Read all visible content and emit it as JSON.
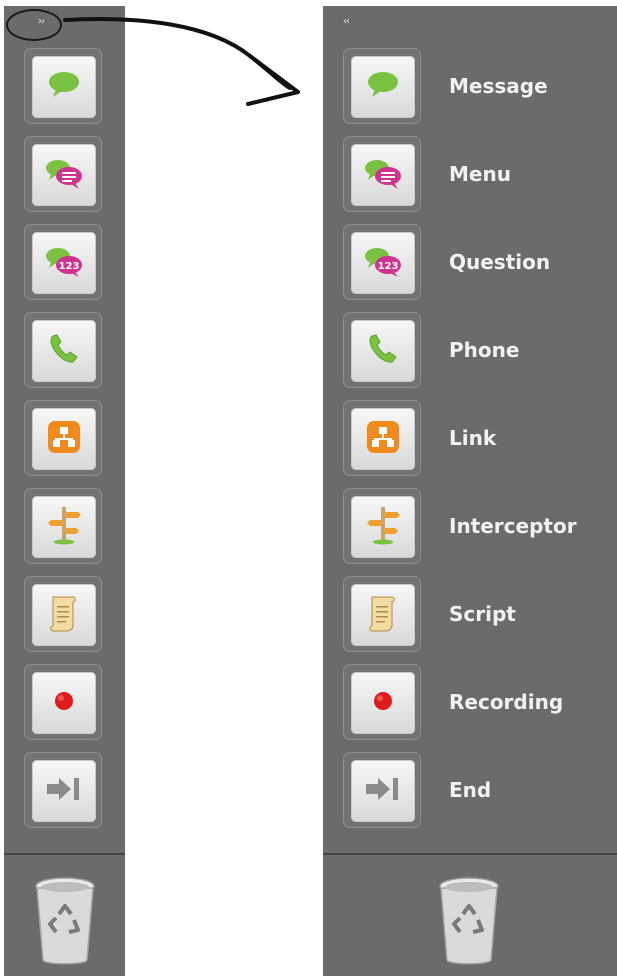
{
  "collapsed_panel": {
    "toggle_label": "››",
    "tools": [
      {
        "id": "message",
        "icon": "speech-bubble-icon"
      },
      {
        "id": "menu",
        "icon": "menu-bubble-icon"
      },
      {
        "id": "question",
        "icon": "question-bubble-icon"
      },
      {
        "id": "phone",
        "icon": "phone-icon"
      },
      {
        "id": "link",
        "icon": "link-icon"
      },
      {
        "id": "interceptor",
        "icon": "signpost-icon"
      },
      {
        "id": "script",
        "icon": "scroll-icon"
      },
      {
        "id": "recording",
        "icon": "record-icon"
      },
      {
        "id": "end",
        "icon": "end-arrow-icon"
      }
    ],
    "trash_icon": "trash-recycle-icon"
  },
  "expanded_panel": {
    "toggle_label": "‹‹",
    "tools": [
      {
        "id": "message",
        "label": "Message",
        "icon": "speech-bubble-icon"
      },
      {
        "id": "menu",
        "label": "Menu",
        "icon": "menu-bubble-icon"
      },
      {
        "id": "question",
        "label": "Question",
        "icon": "question-bubble-icon"
      },
      {
        "id": "phone",
        "label": "Phone",
        "icon": "phone-icon"
      },
      {
        "id": "link",
        "label": "Link",
        "icon": "link-icon"
      },
      {
        "id": "interceptor",
        "label": "Interceptor",
        "icon": "signpost-icon"
      },
      {
        "id": "script",
        "label": "Script",
        "icon": "scroll-icon"
      },
      {
        "id": "recording",
        "label": "Recording",
        "icon": "record-icon"
      },
      {
        "id": "end",
        "label": "End",
        "icon": "end-arrow-icon"
      }
    ],
    "trash_icon": "trash-recycle-icon"
  },
  "icon_badges": {
    "question_badge": "123"
  },
  "colors": {
    "panel_bg": "#6b6b6b",
    "bubble_green": "#7cc242",
    "bubble_magenta": "#d0338f",
    "link_orange": "#f08a1c",
    "record_red": "#e01b1b"
  }
}
